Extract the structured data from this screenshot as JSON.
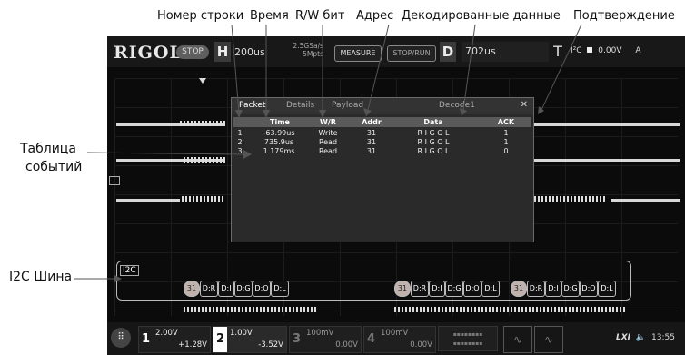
{
  "annotations": {
    "row_number": "Номер строки",
    "time": "Время",
    "rw_bit": "R/W бит",
    "address": "Адрес",
    "decoded_data": "Декодированные данные",
    "ack": "Подтверждение",
    "event_table_line1": "Таблица",
    "event_table_line2": "событий",
    "i2c_bus": "I2C Шина"
  },
  "topbar": {
    "logo": "RIGOL",
    "run_state": "STOP",
    "h_badge": "H",
    "timebase": "200us",
    "sample_rate": "2.5GSa/s",
    "memory_depth": "5Mpts",
    "measure_label": "MEASURE",
    "stoprun_label": "STOP/RUN",
    "d_badge": "D",
    "delay": "702us",
    "t_badge": "T",
    "trigger_source": "I²C",
    "trigger_level": "0.00V",
    "trigger_mode": "A"
  },
  "event_table": {
    "tabs": [
      "Packet",
      "Details",
      "Payload",
      "Decode1"
    ],
    "columns": [
      "Time",
      "W/R",
      "Addr",
      "Data",
      "ACK"
    ],
    "rows": [
      {
        "num": "1",
        "time": "-63.99us",
        "wr": "Write",
        "addr": "31",
        "data": "R I G O L",
        "ack": "1"
      },
      {
        "num": "2",
        "time": "735.9us",
        "wr": "Read",
        "addr": "31",
        "data": "R I G O L",
        "ack": "1"
      },
      {
        "num": "3",
        "time": "1.179ms",
        "wr": "Read",
        "addr": "31",
        "data": "R I G O L",
        "ack": "0"
      }
    ]
  },
  "bus": {
    "label": "I2C",
    "frames": [
      [
        "31",
        "D:R",
        "D:I",
        "D:G",
        "D:O",
        "D:L"
      ],
      [
        "31",
        "D:R",
        "D:I",
        "D:G",
        "D:O",
        "D:L"
      ],
      [
        "31",
        "D:R",
        "D:I",
        "D:G",
        "D:O",
        "D:L"
      ]
    ]
  },
  "channels": [
    {
      "num": "1",
      "scale": "2.00V",
      "offset": "+1.28V",
      "color": "#f2f2f2"
    },
    {
      "num": "2",
      "scale": "1.00V",
      "offset": "-3.52V",
      "color": "#ffffff"
    },
    {
      "num": "3",
      "scale": "100mV",
      "offset": "0.00V",
      "color": "#777777"
    },
    {
      "num": "4",
      "scale": "100mV",
      "offset": "0.00V",
      "color": "#777777"
    }
  ],
  "status": {
    "lxi": "LXI",
    "time": "13:55"
  }
}
